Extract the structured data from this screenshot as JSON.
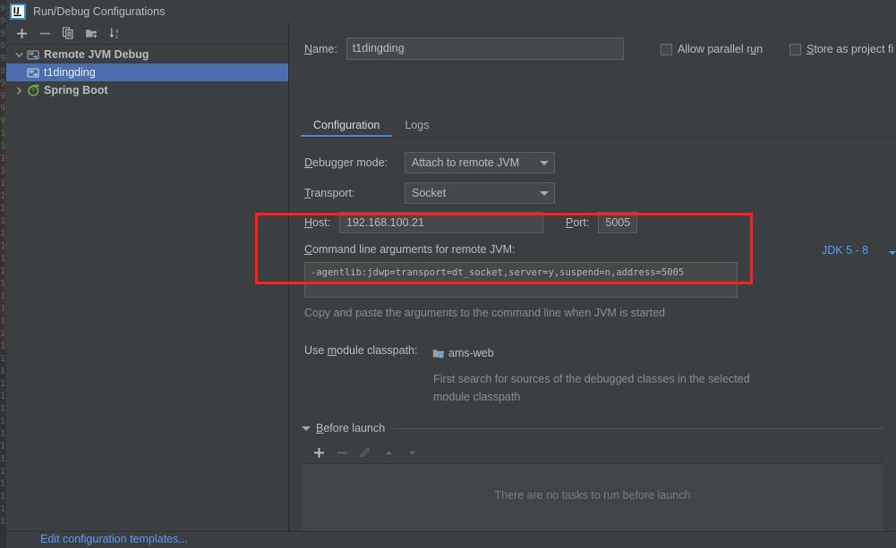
{
  "window": {
    "title": "Run/Debug Configurations",
    "app_icon": "intellij-idea-icon"
  },
  "left_panel": {
    "toolbar": [
      {
        "name": "add-configuration-button",
        "icon": "plus-icon",
        "label": "+"
      },
      {
        "name": "remove-configuration-button",
        "icon": "minus-icon",
        "label": "−"
      },
      {
        "name": "copy-configuration-button",
        "icon": "copy-icon",
        "label": ""
      },
      {
        "name": "save-configuration-button",
        "icon": "folder-add-icon",
        "label": ""
      },
      {
        "name": "sort-configurations-button",
        "icon": "sort-alphabetical-icon",
        "label": ""
      }
    ],
    "tree": [
      {
        "label": "Remote JVM Debug",
        "icon": "remote-jvm-debug-icon",
        "expanded": true,
        "level": 0,
        "selected": false,
        "bold": true
      },
      {
        "label": "t1dingding",
        "icon": "remote-jvm-debug-icon",
        "expanded": null,
        "level": 1,
        "selected": true,
        "bold": false
      },
      {
        "label": "Spring Boot",
        "icon": "spring-boot-icon",
        "expanded": false,
        "level": 0,
        "selected": false,
        "bold": true
      }
    ],
    "edit_templates_link": "Edit configuration templates..."
  },
  "right_panel": {
    "name_label": "Name:",
    "name_value": "t1dingding",
    "allow_parallel_run": {
      "label": "Allow parallel run",
      "checked": false
    },
    "store_as_project_file": {
      "label": "Store as project fi",
      "checked": false
    },
    "tabs": [
      {
        "label": "Configuration",
        "active": true
      },
      {
        "label": "Logs",
        "active": false
      }
    ],
    "debugger_mode": {
      "label": "Debugger mode:",
      "value": "Attach to remote JVM"
    },
    "transport": {
      "label": "Transport:",
      "value": "Socket"
    },
    "host": {
      "label": "Host:",
      "value": "192.168.100.21"
    },
    "port": {
      "label": "Port:",
      "value": "5005"
    },
    "command_line": {
      "label": "Command line arguments for remote JVM:",
      "value": "-agentlib:jdwp=transport=dt_socket,server=y,suspend=n,address=5005",
      "hint": "Copy and paste the arguments to the command line when JVM is started",
      "jdk_selector": "JDK 5 - 8"
    },
    "module_classpath": {
      "label": "Use module classpath:",
      "value": "ams-web",
      "icon": "module-web-icon",
      "hint_line1": "First search for sources of the debugged classes in the selected",
      "hint_line2": "module classpath"
    },
    "before_launch": {
      "title": "Before launch",
      "expanded": true,
      "toolbar": [
        {
          "name": "add-task-button",
          "icon": "plus-icon",
          "enabled": true
        },
        {
          "name": "remove-task-button",
          "icon": "minus-icon",
          "enabled": false
        },
        {
          "name": "edit-task-button",
          "icon": "pencil-icon",
          "enabled": false
        },
        {
          "name": "move-task-up-button",
          "icon": "arrow-up-icon",
          "enabled": false
        },
        {
          "name": "move-task-down-button",
          "icon": "arrow-down-icon",
          "enabled": false
        }
      ],
      "empty_text": "There are no tasks to run before launch"
    }
  },
  "annotation": {
    "type": "red-rectangle-highlight",
    "color": "#ff1f1f"
  },
  "colors": {
    "background": "#3c3f41",
    "panel": "#45494a",
    "selection": "#4b6eaf",
    "link": "#589df6",
    "accent": "#4a88c7",
    "text": "#bbbbbb",
    "muted_text": "#8c8c8c",
    "annotation": "#ff1f1f"
  }
}
